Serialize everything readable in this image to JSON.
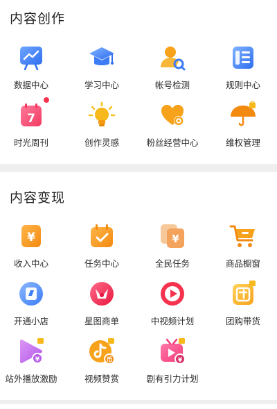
{
  "sections": [
    {
      "title": "内容创作",
      "items": [
        {
          "label": "数据中心",
          "icon": "chart-board-icon"
        },
        {
          "label": "学习中心",
          "icon": "graduation-cap-icon"
        },
        {
          "label": "帐号检测",
          "icon": "user-search-icon"
        },
        {
          "label": "规则中心",
          "icon": "rule-book-icon"
        },
        {
          "label": "时光周刊",
          "icon": "calendar-7-icon",
          "badge": "red-dot"
        },
        {
          "label": "创作灵感",
          "icon": "lightbulb-icon"
        },
        {
          "label": "粉丝经营中心",
          "icon": "heart-gear-icon"
        },
        {
          "label": "维权管理",
          "icon": "umbrella-lock-icon"
        }
      ]
    },
    {
      "title": "内容变现",
      "items": [
        {
          "label": "收入中心",
          "icon": "yuan-card-icon"
        },
        {
          "label": "任务中心",
          "icon": "task-check-icon"
        },
        {
          "label": "全民任务",
          "icon": "yuan-stack-icon"
        },
        {
          "label": "商品橱窗",
          "icon": "shopping-cart-icon"
        },
        {
          "label": "开通小店",
          "icon": "shop-open-icon"
        },
        {
          "label": "星图商单",
          "icon": "star-chart-icon"
        },
        {
          "label": "中视频计划",
          "icon": "video-play-icon"
        },
        {
          "label": "团购带货",
          "icon": "group-buy-lock-icon"
        },
        {
          "label": "站外播放激励",
          "icon": "play-yuan-lock-icon"
        },
        {
          "label": "视频赞赏",
          "icon": "tiktok-yuan-lock-icon"
        },
        {
          "label": "剧有引力计划",
          "icon": "tv-yuan-lock-icon"
        }
      ]
    }
  ],
  "colors": {
    "blue": "#3d7cf5",
    "orange": "#f7a21b",
    "red": "#f5334f",
    "background": "#efefef"
  }
}
